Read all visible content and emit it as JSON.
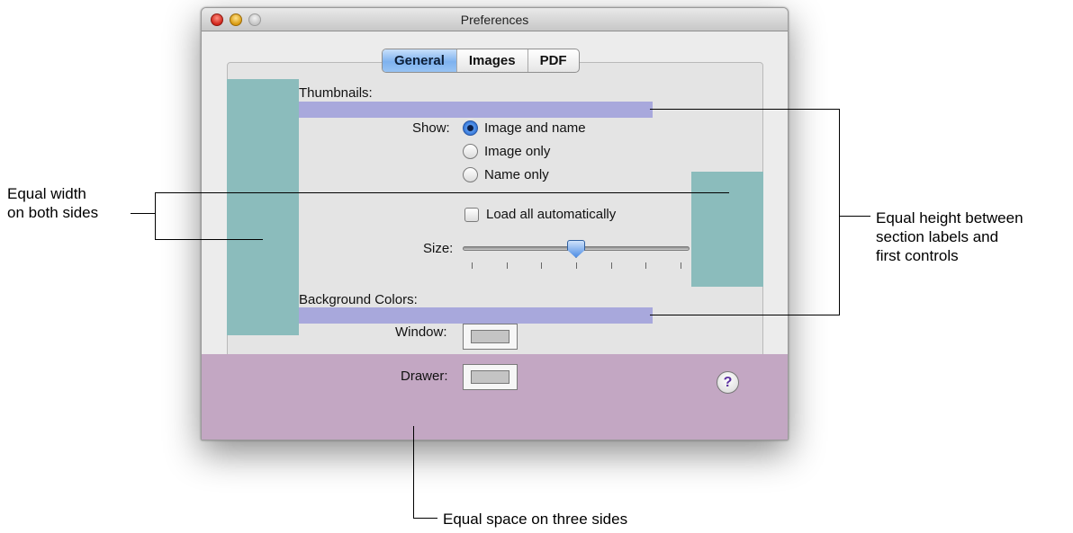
{
  "window": {
    "title": "Preferences",
    "tabs": [
      {
        "label": "General",
        "selected": true
      },
      {
        "label": "Images",
        "selected": false
      },
      {
        "label": "PDF",
        "selected": false
      }
    ]
  },
  "thumbnails": {
    "section_label": "Thumbnails:",
    "show_label": "Show:",
    "options": [
      {
        "label": "Image and name",
        "selected": true
      },
      {
        "label": "Image only",
        "selected": false
      },
      {
        "label": "Name only",
        "selected": false
      }
    ],
    "load_all_label": "Load all automatically",
    "load_all_checked": false,
    "size_label": "Size:",
    "size_value_fraction": 0.5,
    "size_tick_count": 7
  },
  "background_colors": {
    "section_label": "Background Colors:",
    "window_label": "Window:",
    "drawer_label": "Drawer:"
  },
  "help_button_label": "?",
  "callouts": {
    "equal_width": [
      "Equal width",
      "on both sides"
    ],
    "equal_height": [
      "Equal height between",
      "section labels and",
      "first controls"
    ],
    "equal_space": "Equal space on three sides"
  },
  "colors": {
    "teal_guide": "#8bbcbc",
    "lavender_guide": "#a8a8dc",
    "pink_guide": "#c3a7c3"
  }
}
